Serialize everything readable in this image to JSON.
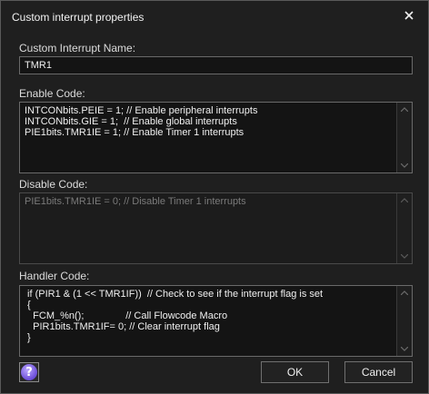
{
  "window": {
    "title": "Custom interrupt properties"
  },
  "name_section": {
    "label": "Custom Interrupt Name:",
    "value": "TMR1"
  },
  "enable_section": {
    "label": "Enable Code:",
    "code": "INTCONbits.PEIE = 1; // Enable peripheral interrupts\nINTCONbits.GIE = 1;  // Enable global interrupts\nPIE1bits.TMR1IE = 1; // Enable Timer 1 interrupts"
  },
  "disable_section": {
    "label": "Disable Code:",
    "code": "PIE1bits.TMR1IE = 0; // Disable Timer 1 interrupts"
  },
  "handler_section": {
    "label": "Handler Code:",
    "code": " if (PIR1 & (1 << TMR1IF))  // Check to see if the interrupt flag is set\n {\n   FCM_%n();               // Call Flowcode Macro\n   PIR1bits.TMR1IF= 0; // Clear interrupt flag\n }"
  },
  "buttons": {
    "ok": "OK",
    "cancel": "Cancel"
  },
  "icons": {
    "close": "close-icon",
    "help": "help-icon",
    "scroll_up": "chevron-up-icon",
    "scroll_down": "chevron-down-icon"
  },
  "colors": {
    "background": "#1f1f1f",
    "field_background": "#141414",
    "border": "#6a6a6a",
    "disabled_text": "#7a7a7a",
    "help_accent": "#6b4cd8"
  }
}
